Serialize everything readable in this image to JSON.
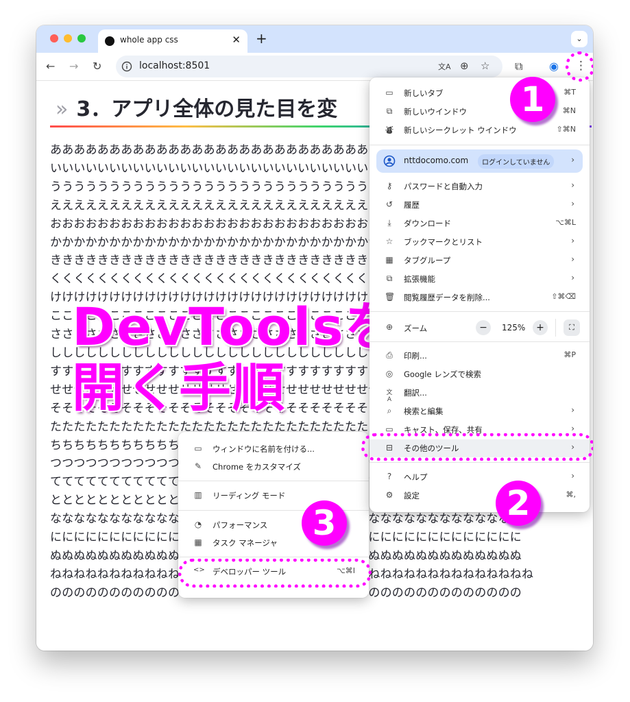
{
  "browser": {
    "tab_title": "whole app css",
    "tab_close": "✕",
    "new_tab": "+",
    "tab_menu": "⌄",
    "url": "localhost:8501",
    "nav_icons": {
      "back": "←",
      "forward": "→",
      "reload": "↻"
    }
  },
  "page": {
    "heading": "3．アプリ全体の見た目を変",
    "heading_prefix": "»",
    "rows": [
      "ああああああああああああああああああああああああああああああああああああああああ",
      "いいいいいいいいいいいいいいいいいいいいいいいいいいいいいいいいいいいいいいいい",
      "うううううううううううううううううううううううううううううううううううううううう",
      "ええええええええええええええええええええええええええええええええええええええええ",
      "おおおおおおおおおおおおおおおおおおおおおおおおおおおおおおおおおおおおおおおお",
      "かかかかかかかかかかかかかかかかかかかかかかかかかかかかかかかかかかかかかかかか",
      "きききききききききききききききききききききききききききききききききききききききき",
      "くくくくくくくくくくくくくくくくくくくくくくくくくくくくくくくくくくくくくくくく",
      "けけけけけけけけけけけけけけけけけけけけけけけけけけけけけけけけけけけけけけけけ",
      "ここここここここここここここここここここここここここここここここここここここここ",
      "ささささささささささささささささささささささささささささささささささささささささ",
      "しししししししししししししししししししししししししししししししししししししししし",
      "すすすすすすすすすすすすすすすすすすすすすすすすすすすすすすすすすすすすすすすす",
      "せせせせせせせせせせせせせせせせせせせせせせせせせせせせせせせせせせせせせせせせ",
      "そそそそそそそそそそそそそそそそそそそそそそそそそそそそそそそそそそそそそそそそ",
      "たたたたたたたたたたたたたたたたたたたたたたたたたたたたたたたたたたたたたたたた",
      "ちちちちちちちちちちちちちちちちちちちちちちちちちちちちちちちちちちちちちちちち",
      "つつつつつつつつつつつつつつつつつつつつつつつつつつつつつつつつつつつつつつつつ",
      "てててててててててててててててててててててててててててててててててててててててて",
      "とととととととととととととととととととととととととととととととととととととととと",
      "なななななななななななななななななななななななななななななななななななななななな",
      "にににににににににににににににににににににににににににににににににににににににに",
      "ぬぬぬぬぬぬぬぬぬぬぬぬぬぬぬぬぬぬぬぬぬぬぬぬぬぬぬぬぬぬぬぬぬぬぬぬぬぬぬぬ",
      "ねねねねねねねねねねねねねねねねねねねねねねねねねねねねねねねねねねねねねねねねね",
      "のののののののののののののののののののののののののののののののののののののののの"
    ]
  },
  "overlay": {
    "title_line1": "DevToolsを",
    "title_line2": "開く手順",
    "step1": "1",
    "step2": "2",
    "step3": "3"
  },
  "menu": {
    "new_tab": {
      "label": "新しいタブ",
      "shortcut": "⌘T"
    },
    "new_window": {
      "label": "新しいウインドウ",
      "shortcut": "⌘N"
    },
    "new_incognito": {
      "label": "新しいシークレット ウインドウ",
      "shortcut": "⇧⌘N"
    },
    "account": {
      "email": "nttdocomo.com",
      "status": "ログインしていません"
    },
    "passwords": {
      "label": "パスワードと自動入力"
    },
    "history": {
      "label": "履歴"
    },
    "downloads": {
      "label": "ダウンロード",
      "shortcut": "⌥⌘L"
    },
    "bookmarks": {
      "label": "ブックマークとリスト"
    },
    "tab_groups": {
      "label": "タブグループ"
    },
    "extensions": {
      "label": "拡張機能"
    },
    "clear_data": {
      "label": "閲覧履歴データを削除...",
      "shortcut": "⇧⌘⌫"
    },
    "zoom": {
      "label": "ズーム",
      "value": "125%",
      "minus": "−",
      "plus": "+"
    },
    "print": {
      "label": "印刷...",
      "shortcut": "⌘P"
    },
    "lens": {
      "label": "Google レンズで検索"
    },
    "translate": {
      "label": "翻訳..."
    },
    "find_edit": {
      "label": "検索と編集"
    },
    "cast": {
      "label": "キャスト、保存、共有"
    },
    "more_tools": {
      "label": "その他のツール"
    },
    "help": {
      "label": "ヘルプ"
    },
    "settings": {
      "label": "設定",
      "shortcut": "⌘,"
    }
  },
  "submenu": {
    "name_window": {
      "label": "ウィンドウに名前を付ける..."
    },
    "customize": {
      "label": "Chrome をカスタマイズ"
    },
    "reading_mode": {
      "label": "リーディング モード"
    },
    "performance": {
      "label": "パフォーマンス"
    },
    "task_manager": {
      "label": "タスク マネージャ"
    },
    "devtools": {
      "label": "デベロッパー ツール",
      "shortcut": "⌥⌘I"
    }
  },
  "colors": {
    "highlight": "#ff00ff",
    "tabbar": "#d3e3fd",
    "account_chip": "#d3e3fd"
  },
  "icons": {
    "chevron": "›",
    "translate_icon": "文A",
    "zoom_icon": "⊕",
    "star_icon": "☆",
    "extension_icon": "⧉",
    "profile_icon": "◉",
    "kebab_icon": "⋮"
  }
}
